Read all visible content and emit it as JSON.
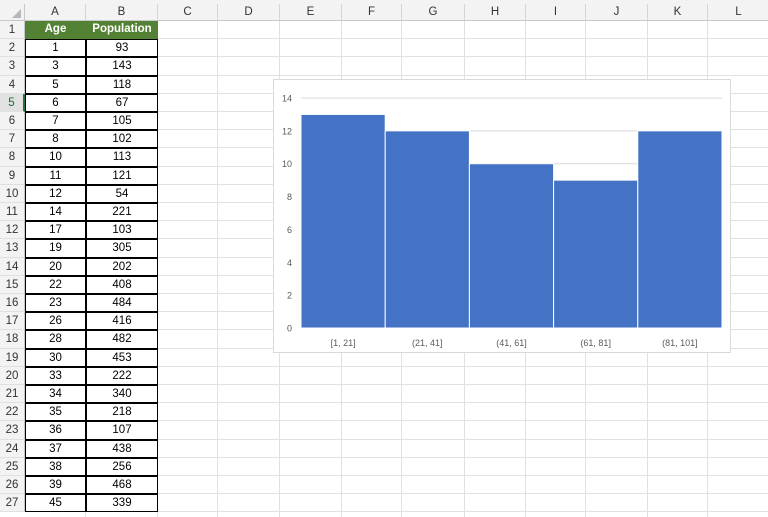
{
  "columns": [
    "A",
    "B",
    "C",
    "D",
    "E",
    "F",
    "G",
    "H",
    "I",
    "J",
    "K",
    "L"
  ],
  "selected_row": 5,
  "table": {
    "headers": [
      "Age",
      "Population"
    ],
    "header_color": "#548235",
    "rows": [
      [
        1,
        93
      ],
      [
        3,
        143
      ],
      [
        5,
        118
      ],
      [
        6,
        67
      ],
      [
        7,
        105
      ],
      [
        8,
        102
      ],
      [
        10,
        113
      ],
      [
        11,
        121
      ],
      [
        12,
        54
      ],
      [
        14,
        221
      ],
      [
        17,
        103
      ],
      [
        19,
        305
      ],
      [
        20,
        202
      ],
      [
        22,
        408
      ],
      [
        23,
        484
      ],
      [
        26,
        416
      ],
      [
        28,
        482
      ],
      [
        30,
        453
      ],
      [
        33,
        222
      ],
      [
        34,
        340
      ],
      [
        35,
        218
      ],
      [
        36,
        107
      ],
      [
        37,
        438
      ],
      [
        38,
        256
      ],
      [
        39,
        468
      ],
      [
        45,
        339
      ]
    ]
  },
  "chart_data": {
    "type": "bar",
    "categories": [
      "[1, 21]",
      "(21, 41]",
      "(41, 61]",
      "(61, 81]",
      "(81, 101]"
    ],
    "values": [
      13,
      12,
      10,
      9,
      12
    ],
    "ylim": [
      0,
      14
    ],
    "yticks": [
      0,
      2,
      4,
      6,
      8,
      10,
      12,
      14
    ],
    "bar_color": "#4472c4",
    "grid": true
  }
}
